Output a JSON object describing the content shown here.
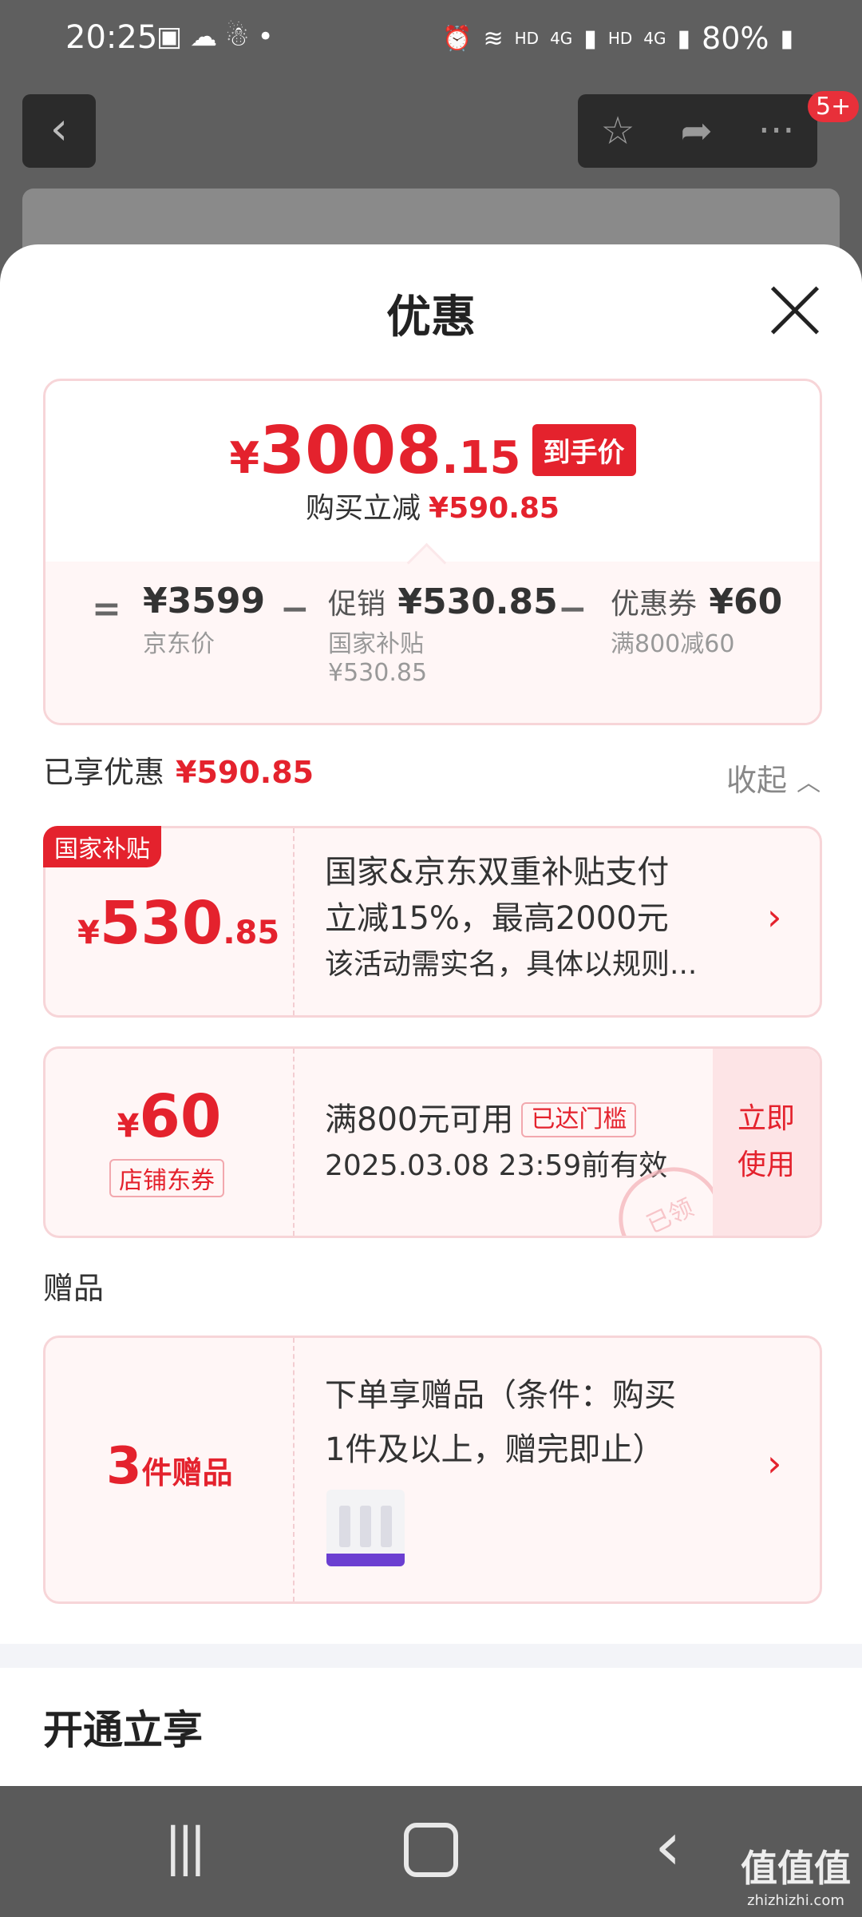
{
  "status_bar": {
    "time": "20:25",
    "battery": "80%",
    "icons_left": [
      "image-icon",
      "wechat-icon",
      "app-icon",
      "dot-icon"
    ],
    "icons_right": [
      "alarm-icon",
      "wifi-icon",
      "HD 4G signal",
      "HD 4G signal"
    ],
    "hd1": "HD",
    "net1": "4G",
    "hd2": "HD",
    "net2": "4G"
  },
  "top_nav": {
    "badge": "5+"
  },
  "sheet": {
    "title": "优惠",
    "summary": {
      "final_symbol": "¥",
      "final_int": "3008",
      "final_dec": ".15",
      "final_tag": "到手价",
      "reduce_label": "购买立减",
      "reduce_amount": "¥590.85",
      "eq": "=",
      "minus": "−",
      "base_amount": "¥3599",
      "base_label": "京东价",
      "promo_label": "促销",
      "promo_amount": "¥530.85",
      "promo_sub1": "国家补贴",
      "promo_sub2": "¥530.85",
      "coupon_label": "优惠券",
      "coupon_amount": "¥60",
      "coupon_sub": "满800减60"
    },
    "enjoyed": {
      "label": "已享优惠",
      "amount": "¥590.85",
      "collapse": "收起"
    },
    "subsidy_card": {
      "ribbon": "国家补贴",
      "symbol": "¥",
      "int": "530",
      "dec": ".85",
      "line1": "国家&京东双重补贴支付",
      "line2": "立减15%，最高2000元",
      "line3": "该活动需实名，具体以规则..."
    },
    "coupon_card": {
      "symbol": "¥",
      "amount": "60",
      "type": "店铺东券",
      "cond": "满800元可用",
      "pill": "已达门槛",
      "expiry": "2025.03.08 23:59前有效",
      "use_line1": "立即",
      "use_line2": "使用",
      "stamp": "已领"
    },
    "gifts": {
      "section": "赠品",
      "count": "3",
      "count_label": "件赠品",
      "line1": "下单享赠品（条件：购买",
      "line2": "1件及以上，赠完即止）"
    },
    "open_title": "开通立享"
  },
  "watermark": {
    "cn": "值值值",
    "en": "zhizhizhi.com"
  }
}
